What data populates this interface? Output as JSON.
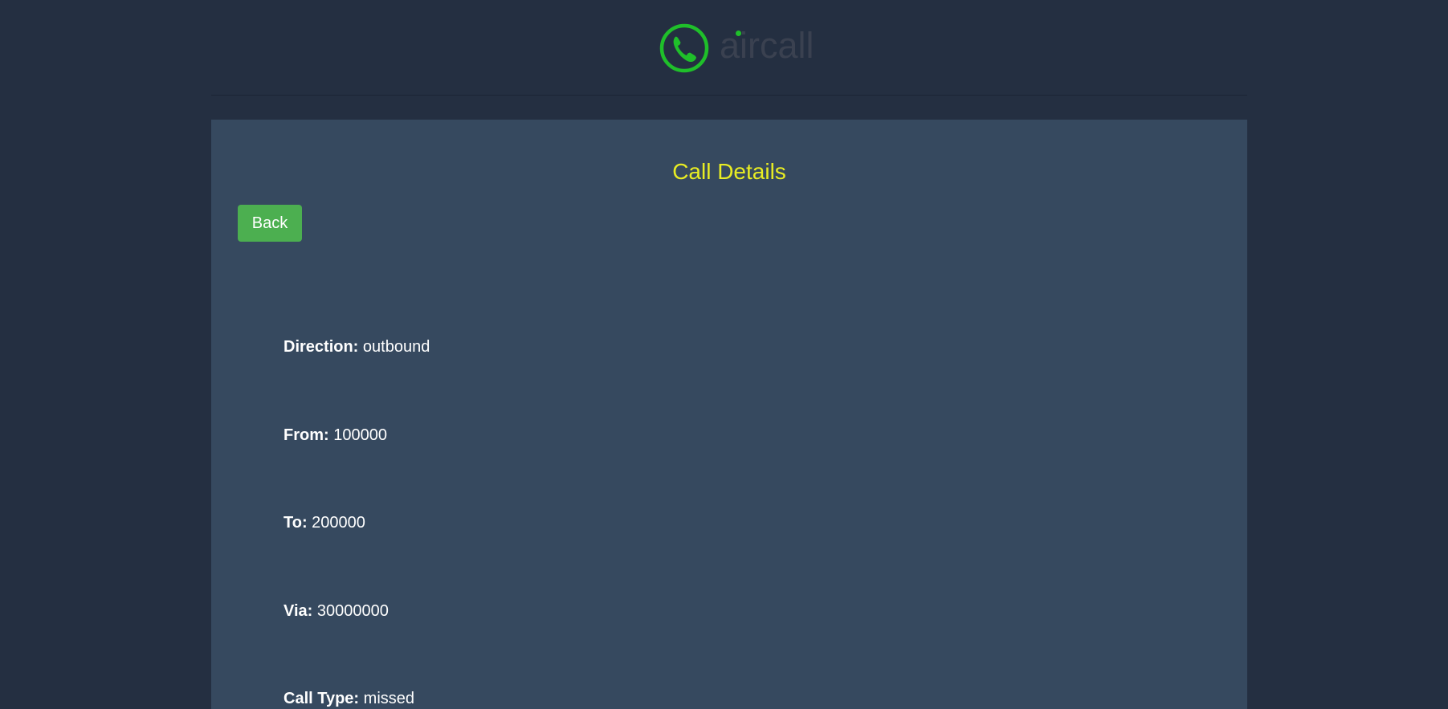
{
  "header": {
    "logo_text": "aircall",
    "logo_icon": "phone-circle-icon"
  },
  "main": {
    "title": "Call Details",
    "back_label": "Back",
    "details": [
      {
        "label": "Direction:",
        "value": "outbound"
      },
      {
        "label": "From:",
        "value": "100000"
      },
      {
        "label": "To:",
        "value": "200000"
      },
      {
        "label": "Via:",
        "value": "30000000"
      },
      {
        "label": "Call Type:",
        "value": "missed"
      }
    ]
  },
  "colors": {
    "background": "#242f41",
    "panel": "#36495f",
    "title": "#e8ec23",
    "button": "#4caf50",
    "logo_green": "#1fbf2a"
  }
}
